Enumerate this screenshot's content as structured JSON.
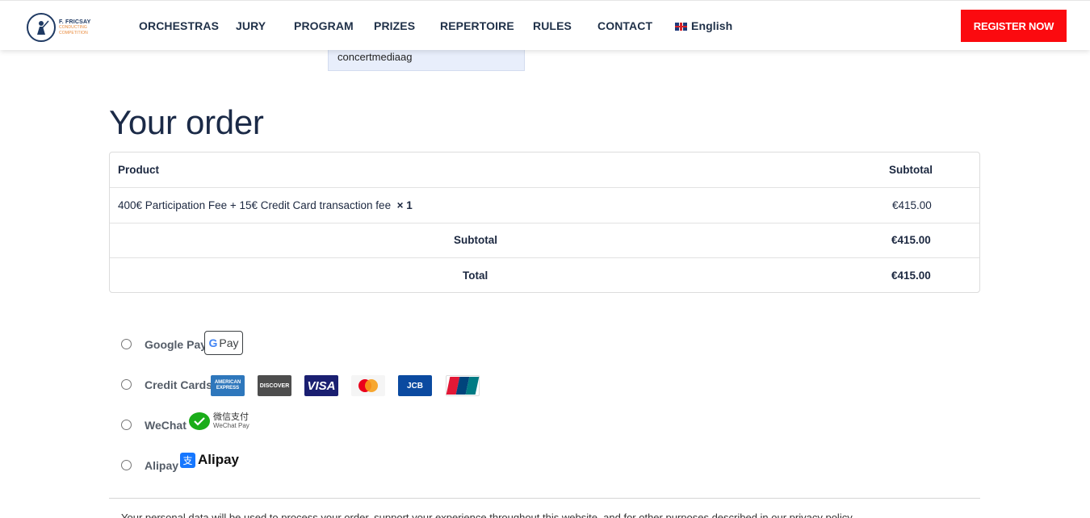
{
  "header": {
    "logo": {
      "line1": "F. FRICSAY",
      "line2": "CONDUCTING",
      "line3": "COMPETITION"
    },
    "nav": [
      "ORCHESTRAS",
      "JURY",
      "PROGRAM",
      "PRIZES",
      "REPERTOIRE",
      "RULES",
      "CONTACT"
    ],
    "language": "English",
    "register_label": "REGISTER NOW"
  },
  "autocomplete": {
    "suggestion": "concertmediaag"
  },
  "order": {
    "title": "Your order",
    "table": {
      "col_product": "Product",
      "col_subtotal": "Subtotal",
      "item_name": "400€ Participation Fee + 15€ Credit Card transaction fee",
      "item_qty": "× 1",
      "item_price": "€415.00",
      "subtotal_label": "Subtotal",
      "subtotal_value": "€415.00",
      "total_label": "Total",
      "total_value": "€415.00"
    }
  },
  "payment_methods": {
    "google_pay": {
      "label": "Google Pay",
      "badge": "Pay"
    },
    "credit_cards": {
      "label": "Credit Cards",
      "cards": [
        "AMERICAN EXPRESS",
        "DISCOVER",
        "VISA",
        "mastercard",
        "JCB",
        "UnionPay"
      ]
    },
    "wechat": {
      "label": "WeChat",
      "brand_cn": "微信支付",
      "brand_en": "WeChat Pay"
    },
    "alipay": {
      "label": "Alipay",
      "brand": "Alipay",
      "mark": "支"
    }
  },
  "colors": {
    "accent": "#fb0a0f",
    "navy": "#1b2a47",
    "autocomplete_bg": "#e8eefb"
  },
  "footer_text": "Your personal data will be used to process your order, support your experience throughout this website, and for other purposes described in our privacy policy."
}
